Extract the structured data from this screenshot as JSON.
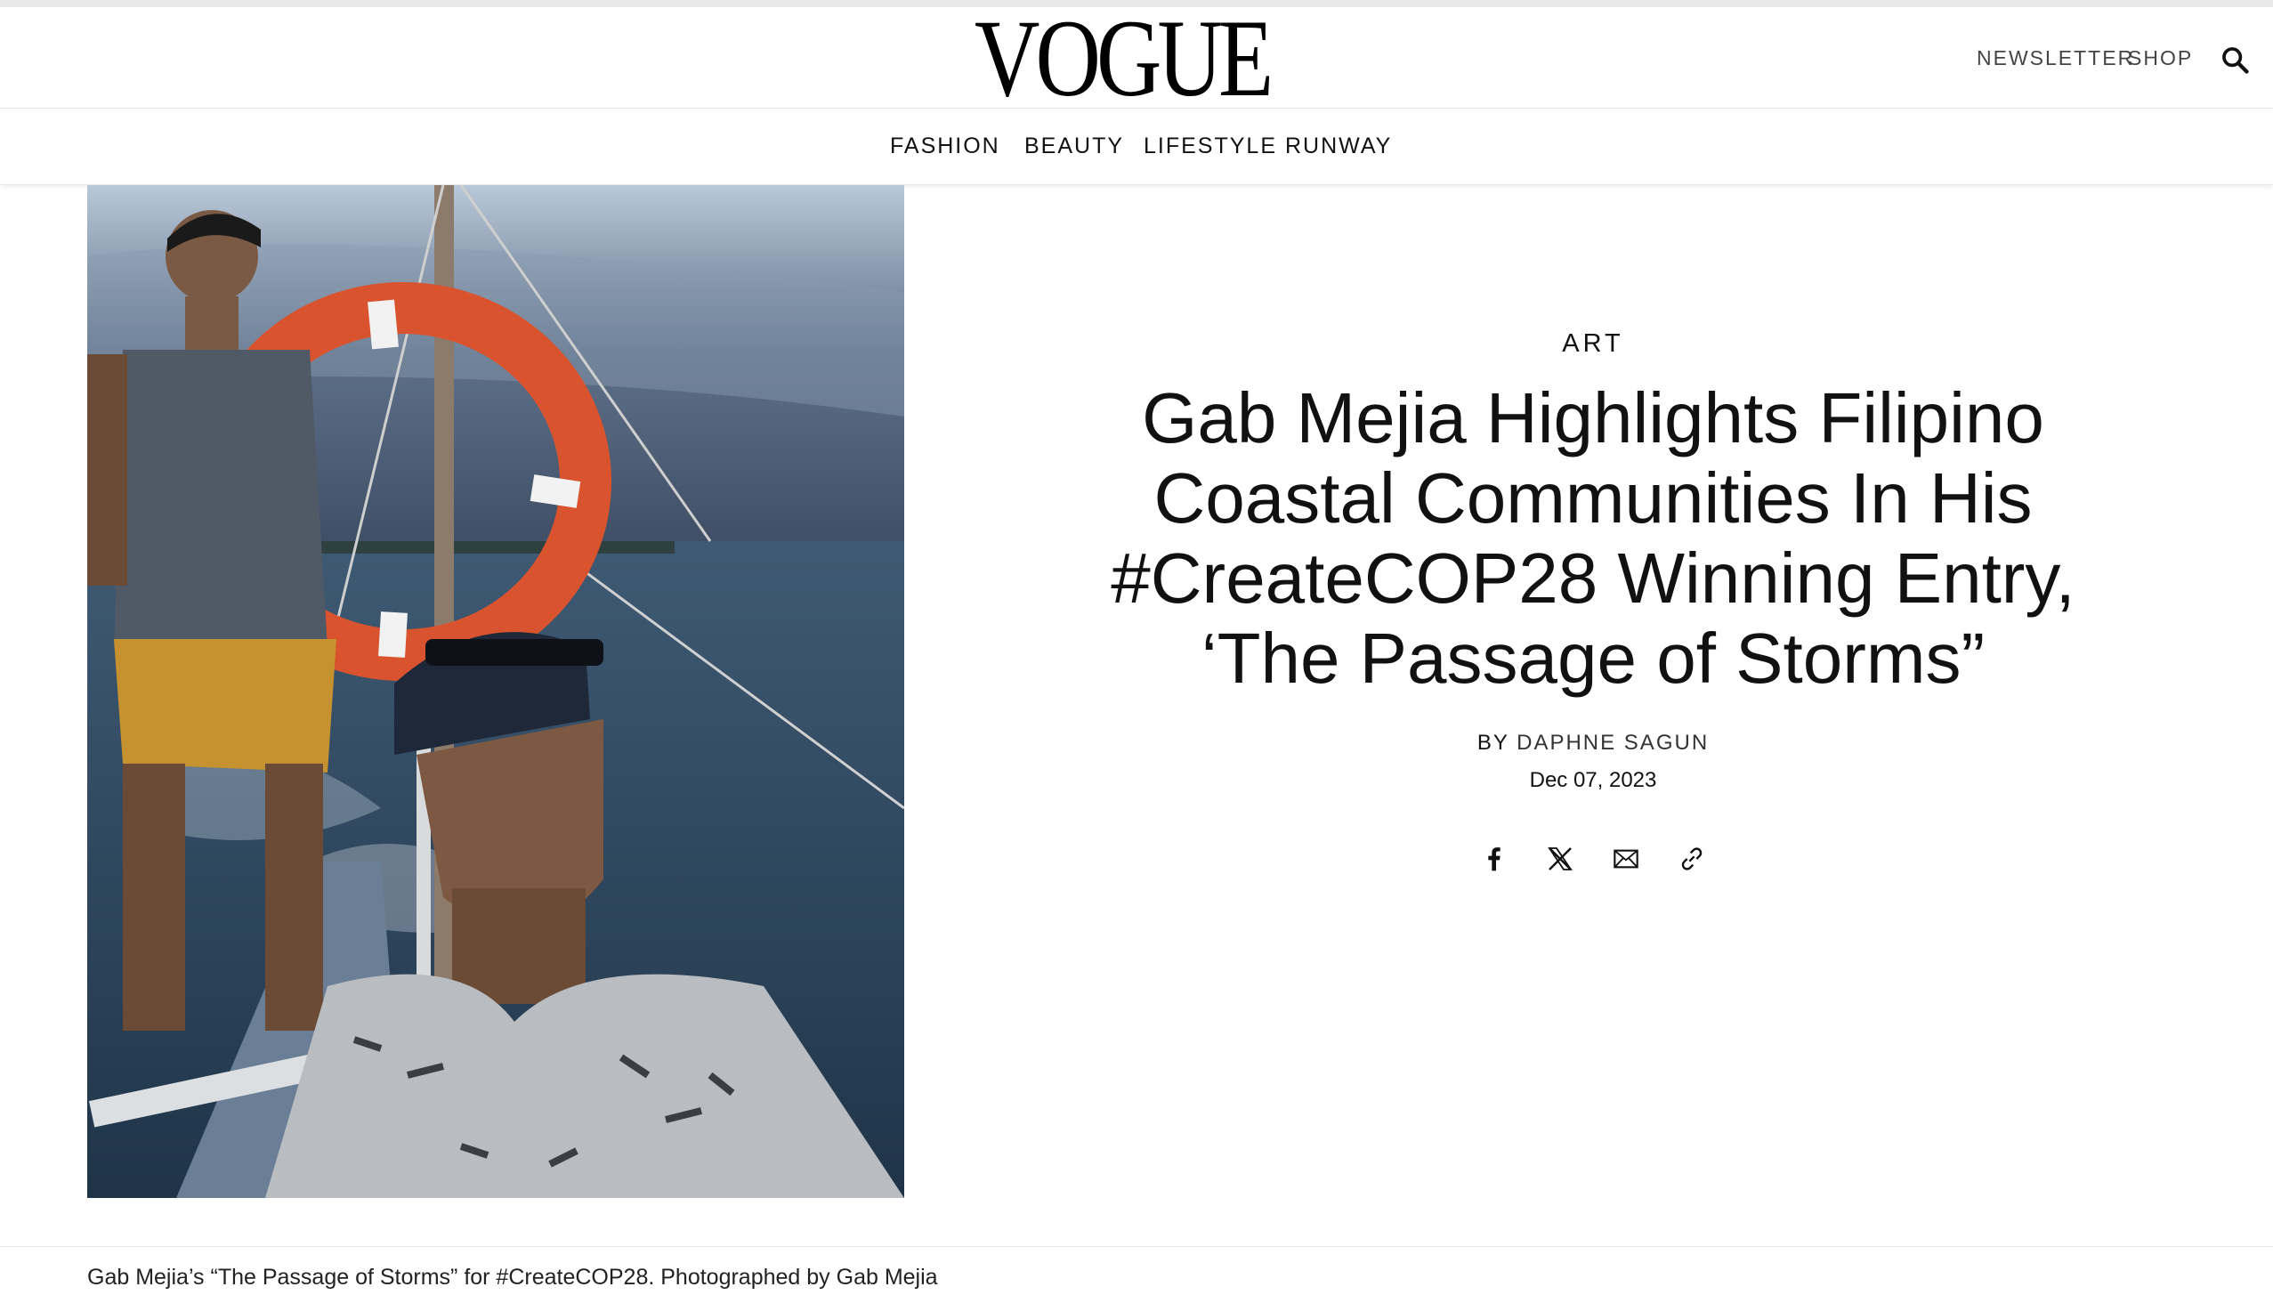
{
  "header": {
    "logo": "VOGUE",
    "newsletter": "NEWSLETTER",
    "shop": "SHOP",
    "search_icon": "search-icon"
  },
  "nav": {
    "items": [
      "FASHION",
      "BEAUTY",
      "LIFESTYLE",
      "RUNWAY"
    ]
  },
  "article": {
    "section": "ART",
    "headline": "Gab Mejia Highlights Filipino Coastal Communities In His #CreateCOP28 Winning Entry, ‘The Passage of Storms”",
    "byline_prefix": "BY",
    "author": "DAPHNE SAGUN",
    "date": "Dec 07, 2023",
    "share_icons": [
      "facebook-icon",
      "x-icon",
      "email-icon",
      "link-icon"
    ],
    "caption": "Gab Mejia’s “The Passage of Storms” for #CreateCOP28. Photographed by Gab Mejia"
  },
  "colors": {
    "text": "#111111",
    "divider": "#e6e6e6",
    "life_ring": "#d9532f"
  }
}
